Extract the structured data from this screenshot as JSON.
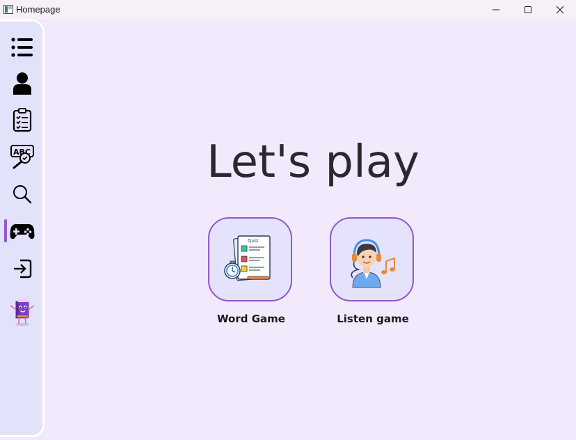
{
  "window": {
    "title": "Homepage",
    "controls": [
      "minimize",
      "maximize",
      "close"
    ]
  },
  "sidebar": {
    "items": [
      {
        "name": "menu",
        "icon": "list-icon"
      },
      {
        "name": "profile",
        "icon": "user-icon"
      },
      {
        "name": "tasks",
        "icon": "clipboard-checklist-icon"
      },
      {
        "name": "spelling",
        "icon": "abc-magnifier-icon"
      },
      {
        "name": "search",
        "icon": "search-icon"
      },
      {
        "name": "games",
        "icon": "gamepad-icon",
        "active": true
      },
      {
        "name": "exit",
        "icon": "sign-in-icon"
      },
      {
        "name": "mascot",
        "icon": "book-mascot-icon"
      }
    ]
  },
  "main": {
    "heading": "Let's play",
    "games": [
      {
        "label": "Word Game",
        "icon": "quiz-clipboard-icon",
        "quiz_text": "Quiz"
      },
      {
        "label": "Listen game",
        "icon": "headphones-person-music-icon"
      }
    ]
  },
  "colors": {
    "background": "#f3e9fc",
    "sidebar": "#e2e2fb",
    "accent": "#8f59cc",
    "card_fill": "#e5e3fb"
  }
}
